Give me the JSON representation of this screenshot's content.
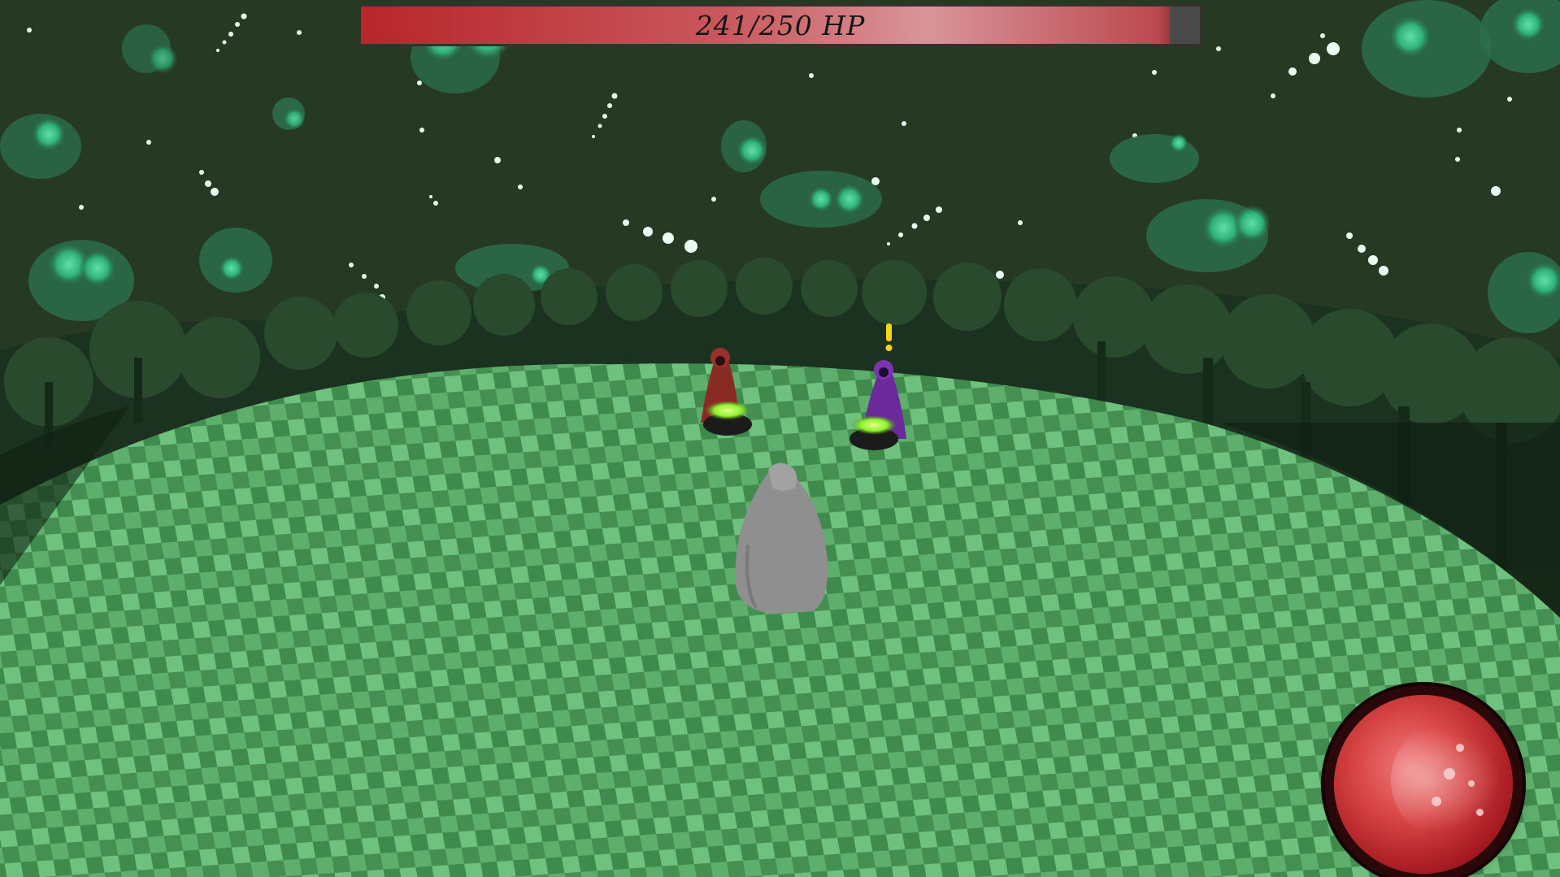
{
  "hud": {
    "hp_text": "241/250 HP",
    "hp_current": 241,
    "hp_max": 250
  },
  "mana": {
    "level": 1.0
  },
  "scene": {
    "sky_color": "#263a23",
    "ground_dark": "#3f8a4d",
    "ground_light": "#6fc27d",
    "tree_color": "#1f3a22",
    "player_color": "#8f8f8f",
    "enemy_red_color": "#8a2a25",
    "enemy_purple_color": "#6a2a9a",
    "potion_glow": "#9cff3a",
    "alert_color": "#f5d515",
    "alert_symbol": "!"
  }
}
